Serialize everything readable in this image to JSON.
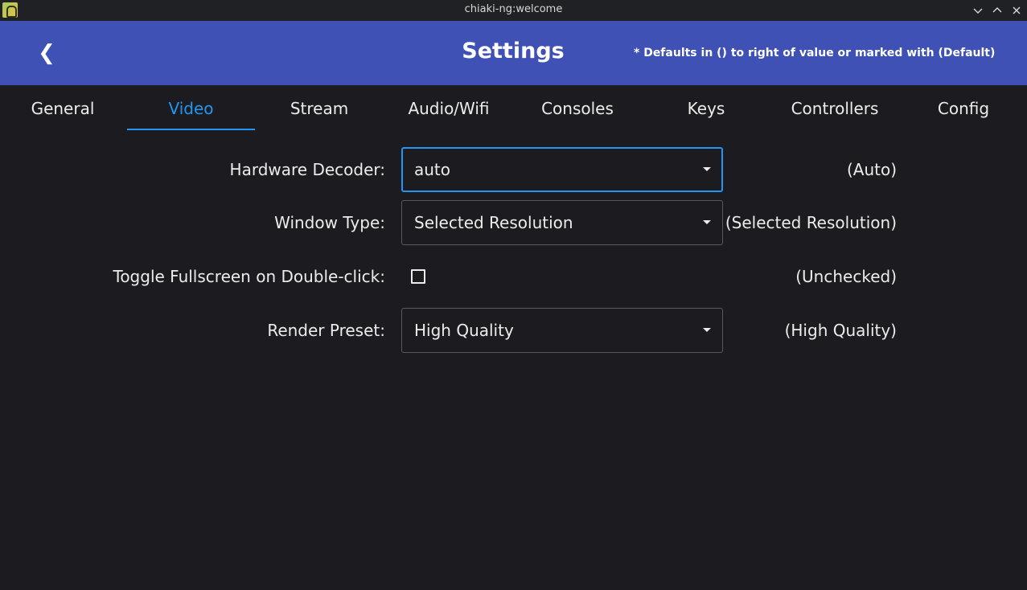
{
  "window": {
    "title": "chiaki-ng:welcome",
    "controls": [
      "chevron-down-icon",
      "chevron-up-icon",
      "close-icon"
    ]
  },
  "header": {
    "back_symbol": "❮",
    "title": "Settings",
    "defaults_note": "* Defaults in () to right of value or marked with (Default)",
    "color": "#3f51b5"
  },
  "tabs": [
    {
      "label": "General",
      "active": false
    },
    {
      "label": "Video",
      "active": true
    },
    {
      "label": "Stream",
      "active": false
    },
    {
      "label": "Audio/Wifi",
      "active": false
    },
    {
      "label": "Consoles",
      "active": false
    },
    {
      "label": "Keys",
      "active": false
    },
    {
      "label": "Controllers",
      "active": false
    },
    {
      "label": "Config",
      "active": false
    }
  ],
  "accent_color": "#2196f3",
  "settings": {
    "hardware_decoder": {
      "label": "Hardware Decoder:",
      "value": "auto",
      "default": "(Auto)"
    },
    "window_type": {
      "label": "Window Type:",
      "value": "Selected Resolution",
      "default": "(Selected Resolution)"
    },
    "toggle_fullscreen": {
      "label": "Toggle Fullscreen on Double-click:",
      "checked": false,
      "default": "(Unchecked)"
    },
    "render_preset": {
      "label": "Render Preset:",
      "value": "High Quality",
      "default": "(High Quality)"
    }
  }
}
